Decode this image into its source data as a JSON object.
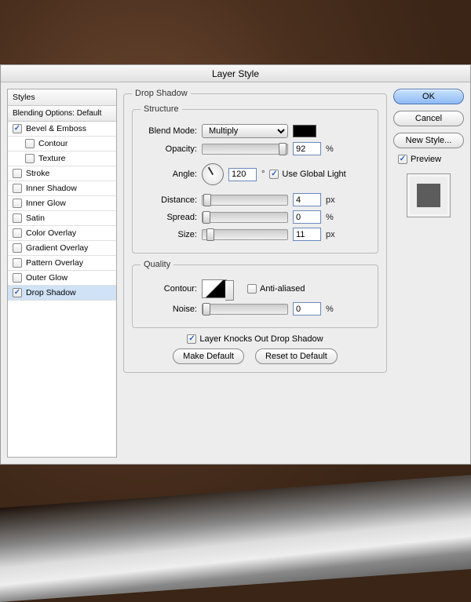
{
  "title": "Layer Style",
  "sidebar": {
    "header": "Styles",
    "blending": "Blending Options: Default",
    "items": [
      {
        "label": "Bevel & Emboss",
        "checked": true,
        "indent": false
      },
      {
        "label": "Contour",
        "checked": false,
        "indent": true
      },
      {
        "label": "Texture",
        "checked": false,
        "indent": true
      },
      {
        "label": "Stroke",
        "checked": false,
        "indent": false
      },
      {
        "label": "Inner Shadow",
        "checked": false,
        "indent": false
      },
      {
        "label": "Inner Glow",
        "checked": false,
        "indent": false
      },
      {
        "label": "Satin",
        "checked": false,
        "indent": false
      },
      {
        "label": "Color Overlay",
        "checked": false,
        "indent": false
      },
      {
        "label": "Gradient Overlay",
        "checked": false,
        "indent": false
      },
      {
        "label": "Pattern Overlay",
        "checked": false,
        "indent": false
      },
      {
        "label": "Outer Glow",
        "checked": false,
        "indent": false
      },
      {
        "label": "Drop Shadow",
        "checked": true,
        "indent": false,
        "selected": true
      }
    ]
  },
  "structure": {
    "legend_outer": "Drop Shadow",
    "legend": "Structure",
    "blend_mode_label": "Blend Mode:",
    "blend_mode_value": "Multiply",
    "opacity_label": "Opacity:",
    "opacity_value": "92",
    "opacity_unit": "%",
    "angle_label": "Angle:",
    "angle_value": "120",
    "angle_unit": "°",
    "global_light_label": "Use Global Light",
    "global_light_checked": true,
    "distance_label": "Distance:",
    "distance_value": "4",
    "distance_unit": "px",
    "spread_label": "Spread:",
    "spread_value": "0",
    "spread_unit": "%",
    "size_label": "Size:",
    "size_value": "11",
    "size_unit": "px",
    "swatch_color": "#000000"
  },
  "quality": {
    "legend": "Quality",
    "contour_label": "Contour:",
    "anti_aliased_label": "Anti-aliased",
    "anti_aliased_checked": false,
    "noise_label": "Noise:",
    "noise_value": "0",
    "noise_unit": "%"
  },
  "footer": {
    "knockout_label": "Layer Knocks Out Drop Shadow",
    "knockout_checked": true,
    "make_default": "Make Default",
    "reset_default": "Reset to Default"
  },
  "right": {
    "ok": "OK",
    "cancel": "Cancel",
    "new_style": "New Style...",
    "preview_label": "Preview",
    "preview_checked": true
  }
}
